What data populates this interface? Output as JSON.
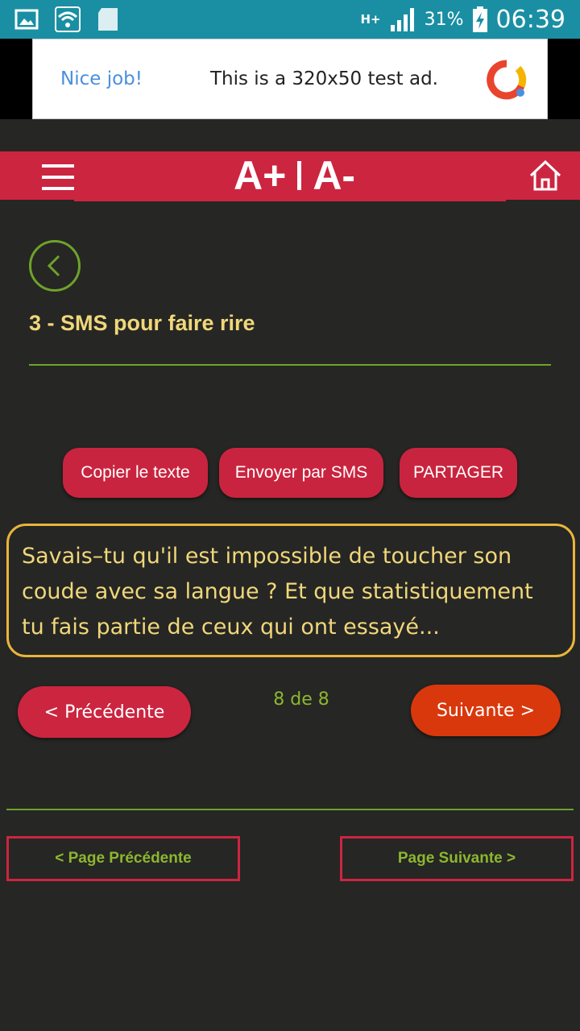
{
  "status_bar": {
    "network": "H+",
    "battery_percent": "31%",
    "time": "06:39",
    "icons": [
      "gallery-icon",
      "wifi-icon",
      "sd-card-icon",
      "signal-icon",
      "battery-charging-icon"
    ]
  },
  "ad": {
    "nice": "Nice job!",
    "text": "This is a 320x50 test ad."
  },
  "header": {
    "font_increase": "A+",
    "font_decrease": "A-"
  },
  "page": {
    "title": "3 - SMS pour faire rire"
  },
  "actions": {
    "copy": "Copier le texte",
    "sms": "Envoyer par SMS",
    "share": "PARTAGER"
  },
  "message": {
    "text": "Savais–tu qu'il est impossible de toucher son coude avec sa langue ? Et que statistiquement tu fais partie de ceux qui ont essayé..."
  },
  "nav": {
    "prev": "< Précédente",
    "next": "Suivante >",
    "counter": "8 de 8"
  },
  "pagination": {
    "prev_page": "< Page Précédente",
    "next_page": "Page Suivante >"
  },
  "colors": {
    "background": "#262624",
    "header_red": "#cc2540",
    "accent_green": "#6ea22a",
    "title_yellow": "#f0d77a",
    "next_orange": "#d9380d"
  }
}
